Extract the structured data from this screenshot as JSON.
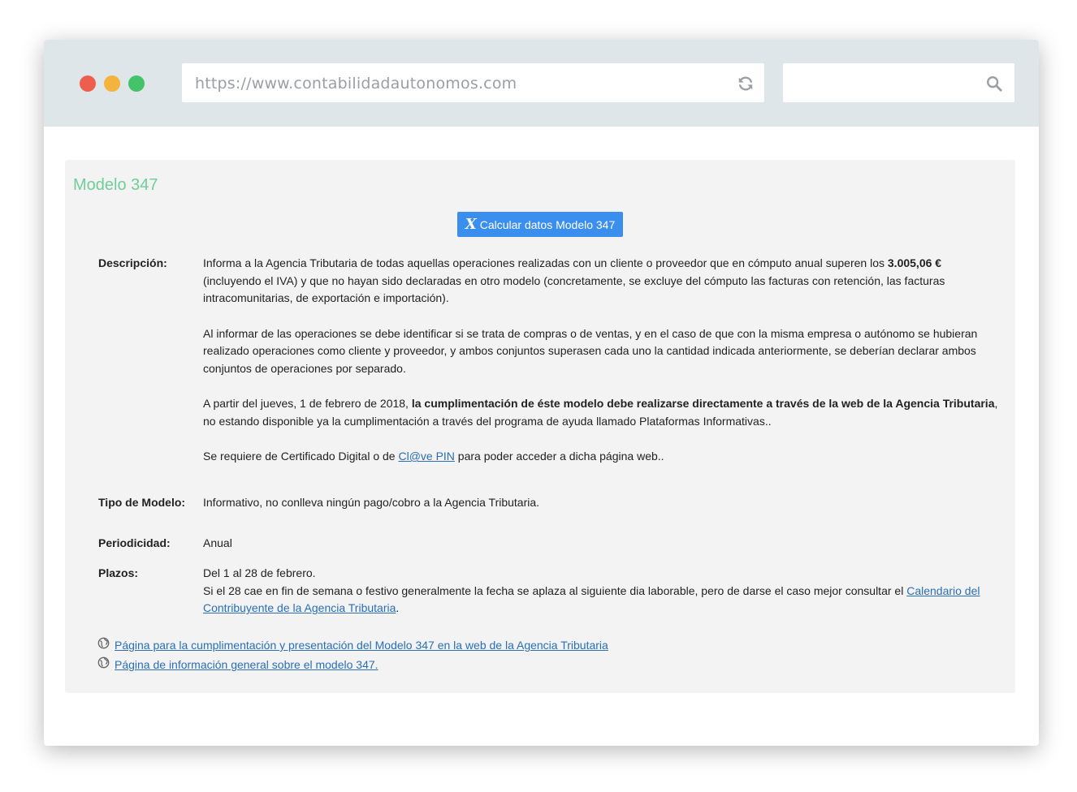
{
  "browser": {
    "url": "https://www.contabilidadautonomos.com",
    "search_placeholder": "",
    "colors": {
      "red": "#ed5e4f",
      "yellow": "#f3b33d",
      "green": "#44c46a"
    }
  },
  "page": {
    "title": "Modelo 347",
    "calc_button": "Calcular datos Modelo 347",
    "descripcion": {
      "label": "Descripción:",
      "p1_a": "Informa a la Agencia Tributaria de todas aquellas operaciones realizadas con un cliente o proveedor que en cómputo anual superen los ",
      "p1_b": "3.005,06 €",
      "p1_c": " (incluyendo el IVA) y que no hayan sido declaradas en otro modelo (concretamente, se excluye del cómputo las facturas con retención, las facturas intracomunitarias, de exportación e importación).",
      "p2": "Al informar de las operaciones se debe identificar si se trata de compras o de ventas, y en el caso de que con la misma empresa o autónomo se hubieran realizado operaciones como cliente y proveedor, y ambos conjuntos superasen cada uno la cantidad indicada anteriormente, se deberían declarar ambos conjuntos de operaciones por separado.",
      "p3_a": "A partir del jueves, 1 de febrero de 2018, ",
      "p3_b": "la cumplimentación de éste modelo debe realizarse directamente a través de la web de la Agencia Tributaria",
      "p3_c": ", no estando disponible ya la cumplimentación a través del programa de ayuda llamado Plataformas Informativas..",
      "p4_a": "Se requiere de Certificado Digital o de ",
      "p4_link": "Cl@ve PIN",
      "p4_c": " para poder acceder a dicha página web.."
    },
    "tipo": {
      "label": "Tipo de Modelo:",
      "value": "Informativo, no conlleva ningún pago/cobro a la Agencia Tributaria."
    },
    "periodicidad": {
      "label": "Periodicidad:",
      "value": "Anual"
    },
    "plazos": {
      "label": "Plazos:",
      "line1": "Del 1 al 28 de febrero.",
      "line2_a": "Si el 28 cae en fin de semana o festivo generalmente la fecha se aplaza al siguiente dia laborable, pero de darse el caso mejor consultar el ",
      "line2_link": "Calendario del Contribuyente de la Agencia Tributaria",
      "line2_c": "."
    },
    "links": [
      "Página para la cumplimentación y presentación del Modelo 347 en la web de la Agencia Tributaria ",
      "Página de información general sobre el modelo 347. "
    ]
  }
}
